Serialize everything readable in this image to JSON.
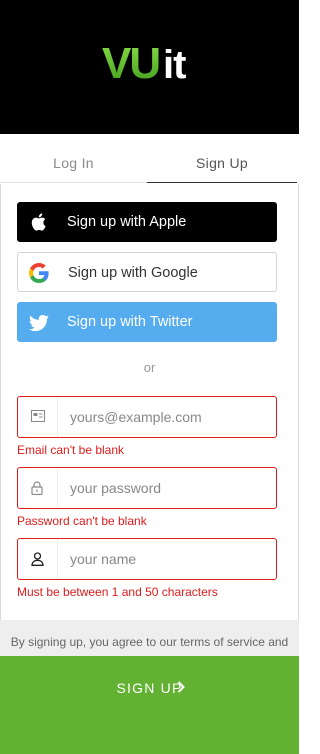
{
  "brand": {
    "logo_text": "VUit"
  },
  "tabs": [
    {
      "label": "Log In",
      "active": false
    },
    {
      "label": "Sign Up",
      "active": true
    }
  ],
  "social": {
    "apple": {
      "label": "Sign up with Apple",
      "icon": "apple-icon",
      "color": "#000000"
    },
    "google": {
      "label": "Sign up with Google",
      "icon": "google-icon",
      "color": "#ffffff"
    },
    "twitter": {
      "label": "Sign up with Twitter",
      "icon": "twitter-icon",
      "color": "#55acee"
    }
  },
  "divider_text": "or",
  "form": {
    "email": {
      "placeholder": "yours@example.com",
      "value": "",
      "error": "Email can't be blank",
      "icon": "envelope-icon"
    },
    "password": {
      "placeholder": "your password",
      "value": "",
      "error": "Password can't be blank",
      "icon": "lock-icon"
    },
    "name": {
      "placeholder": "your name",
      "value": "",
      "error": "Must be between 1 and 50 characters",
      "icon": "user-icon"
    }
  },
  "terms_text": "By signing up, you agree to our terms of service and privacy policy.",
  "submit": {
    "label": "SIGN UP",
    "icon": "chevron-right-icon",
    "color": "#63b132"
  },
  "colors": {
    "error": "#e01b1b",
    "accent": "#63b132"
  }
}
